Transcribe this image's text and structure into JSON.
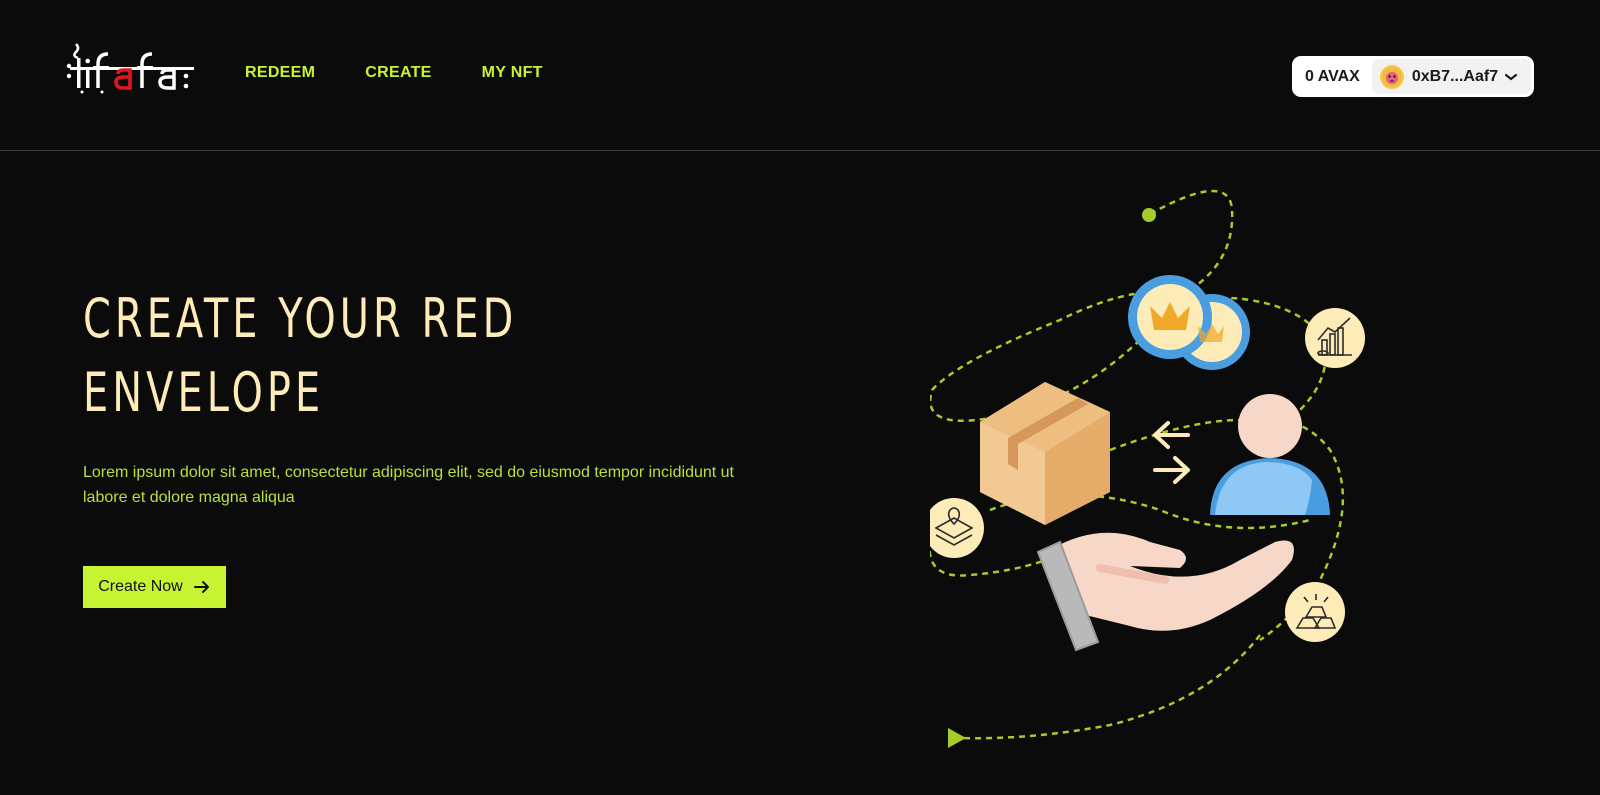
{
  "header": {
    "logo_text": "lifafa",
    "nav": [
      {
        "label": "REDEEM"
      },
      {
        "label": "CREATE"
      },
      {
        "label": "MY NFT"
      }
    ],
    "wallet": {
      "balance": "0 AVAX",
      "address": "0xB7...Aaf7"
    }
  },
  "hero": {
    "title_line1": "CREATE YOUR RED",
    "title_line2": "ENVELOPE",
    "description_line1": "Lorem ipsum dolor sit amet, consectetur adipiscing elit, sed do eiusmod tempor incididunt ut",
    "description_line2": "labore et dolore magna aliqua",
    "cta_label": "Create Now"
  },
  "colors": {
    "background": "#0b0b0b",
    "accent": "#c6f432",
    "title": "#fdecb8",
    "logo_red": "#e3161f"
  },
  "icons": [
    "arrow-right-icon",
    "chevron-down-icon",
    "avatar-icon",
    "crown-coin-icon",
    "box-icon",
    "person-icon",
    "hand-icon",
    "chart-icon",
    "location-icon",
    "gold-bars-icon"
  ]
}
